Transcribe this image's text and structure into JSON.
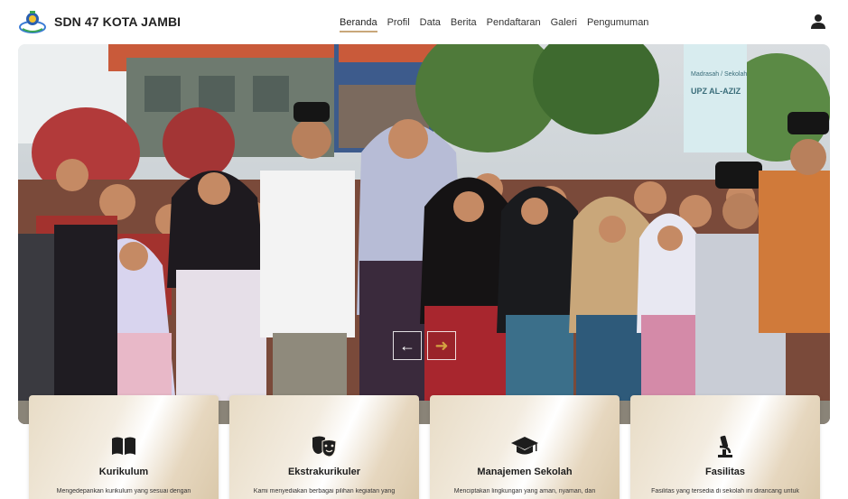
{
  "header": {
    "school_name": "SDN 47 KOTA JAMBI",
    "logo_icon": "school-logo",
    "user_icon": "user-icon"
  },
  "nav": {
    "items": [
      {
        "label": "Beranda",
        "active": true
      },
      {
        "label": "Profil",
        "active": false
      },
      {
        "label": "Data",
        "active": false
      },
      {
        "label": "Berita",
        "active": false
      },
      {
        "label": "Pendaftaran",
        "active": false
      },
      {
        "label": "Galeri",
        "active": false
      },
      {
        "label": "Pengumuman",
        "active": false
      }
    ]
  },
  "hero": {
    "banner_text": "UPZ AL-AZIZ",
    "banner_subtext": "Madrasah / Sekolah",
    "prev_icon": "arrow-left-icon",
    "next_icon": "arrow-right-icon"
  },
  "cards": [
    {
      "icon": "book-icon",
      "title": "Kurikulum",
      "desc": "Mengedepankan kurikulum yang sesuai dengan"
    },
    {
      "icon": "theater-masks-icon",
      "title": "Ekstrakurikuler",
      "desc": "Kami menyediakan berbagai pilihan kegiatan yang"
    },
    {
      "icon": "graduation-cap-icon",
      "title": "Manajemen Sekolah",
      "desc": "Menciptakan lingkungan yang aman, nyaman, dan"
    },
    {
      "icon": "microscope-icon",
      "title": "Fasilitas",
      "desc": "Fasilitas yang tersedia di sekolah ini dirancang untuk"
    }
  ],
  "colors": {
    "accent": "#c9a77a",
    "card_gradient_start": "#e8dcc6",
    "text_dark": "#222222"
  }
}
